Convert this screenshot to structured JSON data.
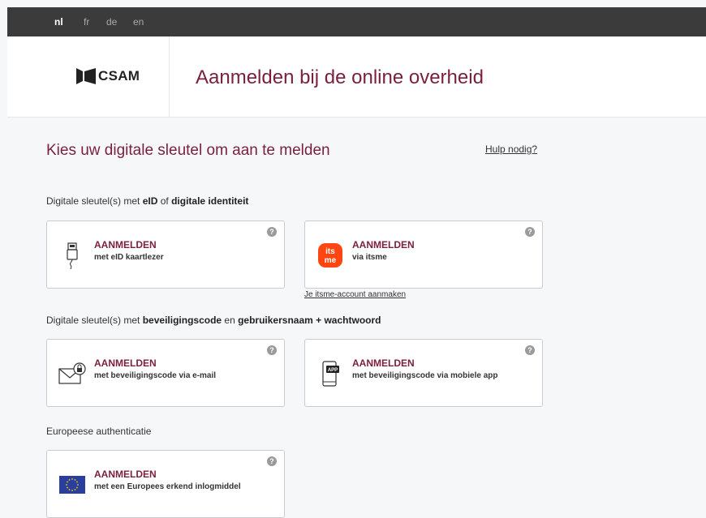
{
  "languages": [
    "nl",
    "fr",
    "de",
    "en"
  ],
  "active_language": "nl",
  "logo": {
    "text": "CSAM"
  },
  "header": {
    "title": "Aanmelden bij de online overheid"
  },
  "main": {
    "title": "Kies uw digitale sleutel om aan te melden",
    "help_link": "Hulp nodig?"
  },
  "sections": [
    {
      "label_parts": [
        "Digitale sleutel(s) met ",
        "eID",
        " of ",
        "digitale identiteit"
      ],
      "cards": [
        {
          "title": "AANMELDEN",
          "subtitle": "met eID kaartlezer",
          "icon": "card-reader-icon"
        },
        {
          "title": "AANMELDEN",
          "subtitle": "via itsme",
          "icon": "itsme-icon"
        }
      ],
      "extra_link": "Je itsme-account aanmaken"
    },
    {
      "label_parts": [
        "Digitale sleutel(s) met ",
        "beveiligingscode",
        " en ",
        "gebruikersnaam + wachtwoord"
      ],
      "cards": [
        {
          "title": "AANMELDEN",
          "subtitle": "met beveiligingscode via e-mail",
          "icon": "envelope-lock-icon"
        },
        {
          "title": "AANMELDEN",
          "subtitle": "met beveiligingscode via mobiele app",
          "icon": "mobile-app-icon",
          "icon_text": "APP"
        }
      ]
    },
    {
      "label": "Europeese authenticatie",
      "cards": [
        {
          "title": "AANMELDEN",
          "subtitle": "met een Europees erkend inlogmiddel",
          "icon": "eu-flag-icon"
        }
      ]
    }
  ],
  "help_icon_glyph": "?",
  "itsme_text": [
    "its",
    "me"
  ],
  "colors": {
    "accent": "#7a1f3d",
    "topbar": "#3b3b3b",
    "itsme": "#ff4612",
    "eu_blue": "#2a3f9d",
    "eu_star": "#f5d000"
  }
}
